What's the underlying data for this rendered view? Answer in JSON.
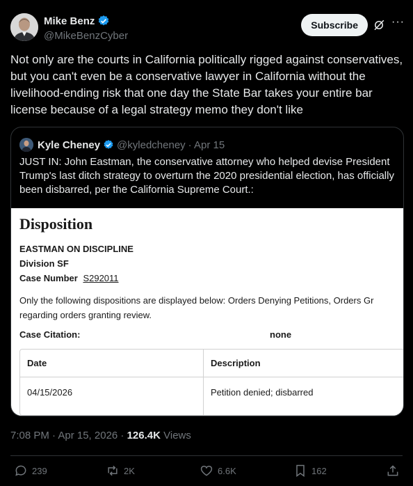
{
  "author": {
    "name": "Mike Benz",
    "handle": "@MikeBenzCyber",
    "verified_color": "#1d9bf0"
  },
  "header": {
    "subscribe_label": "Subscribe",
    "more_label": "···"
  },
  "tweet": {
    "text": "Not only are the courts in California politically rigged against conservatives, but you can't even be a conservative lawyer in California without the livelihood-ending risk that one day the State Bar takes your entire bar license because of a legal strategy memo they don't like"
  },
  "quote": {
    "name": "Kyle Cheney",
    "handle": "@kyledcheney",
    "date": "· Apr 15",
    "text": "JUST IN: John Eastman, the conservative attorney who helped devise President Trump's last ditch strategy to overturn the 2020 presidential election, has officially been disbarred, per the California Supreme Court.:",
    "doc": {
      "title": "Disposition",
      "case_name": "EASTMAN ON DISCIPLINE",
      "division": "Division SF",
      "case_number_label": "Case Number",
      "case_number": "S292011",
      "note_line1": "Only the following dispositions are displayed below: Orders Denying Petitions, Orders Gr",
      "note_line2": "regarding orders granting review.",
      "citation_label": "Case Citation:",
      "citation_value": "none",
      "table": {
        "headers": [
          "Date",
          "Description"
        ],
        "rows": [
          [
            "04/15/2026",
            "Petition denied; disbarred"
          ]
        ]
      }
    }
  },
  "meta": {
    "time": "7:08 PM · Apr 15, 2026 · ",
    "views_count": "126.4K",
    "views_label": " Views"
  },
  "actions": {
    "replies": "239",
    "reposts": "2K",
    "likes": "6.6K",
    "bookmarks": "162"
  }
}
